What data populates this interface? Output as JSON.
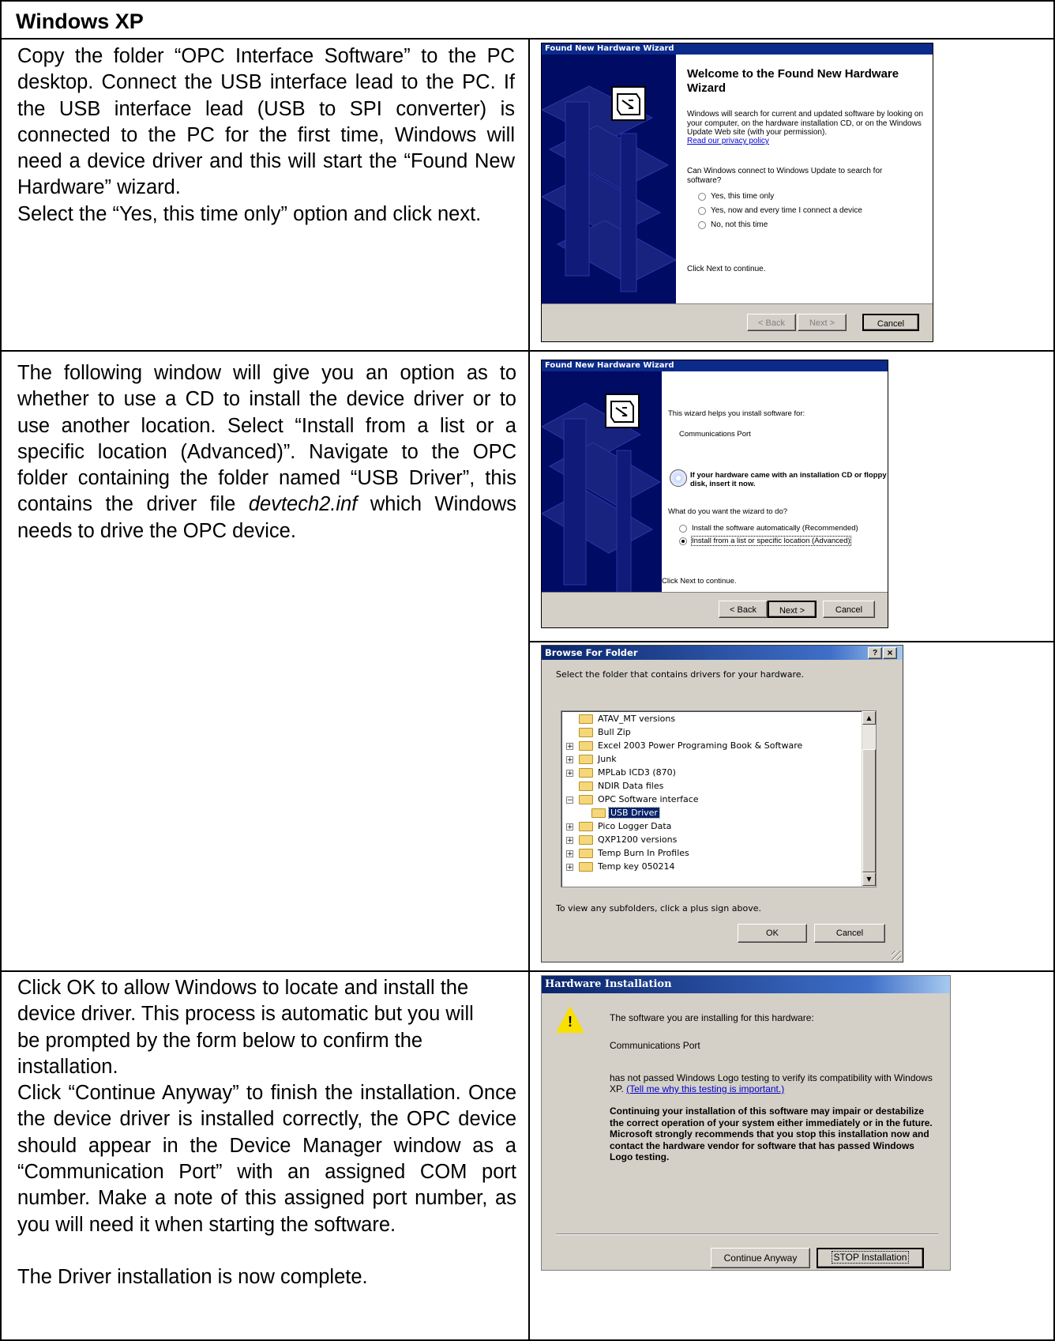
{
  "section_title": "Windows XP",
  "row1_text": "Copy the folder “OPC Interface Software” to the PC desktop.  Connect the USB interface lead to the PC.  If the USB interface lead (USB to SPI converter) is connected to the PC for the first time, Windows will need a device driver and this will start the “Found New Hardware” wizard.",
  "row1_text2": "Select the “Yes, this time only” option and click next.",
  "row2_text_a": "The following window will give you an option as to whether to use a CD to install the device driver or to use another location.  Select “Install from a list or a specific location (Advanced)”.  Navigate to the OPC folder containing the folder named “USB Driver”, this contains the driver file ",
  "row2_text_italic": "devtech2.inf",
  "row2_text_b": " which Windows needs to drive the OPC device.",
  "row3_text_a": "Click OK to allow Windows to locate and install the device driver.  This process is automatic but you will be prompted by the form below to confirm the installation.",
  "row3_text_b": "Click “Continue Anyway” to finish the installation.  Once the device driver is installed correctly, the OPC device should appear in the Device Manager window as a “Communication Port” with an assigned COM port number.  Make a note of this assigned port number, as you will need it when starting the software.",
  "row3_text_c": "The Driver installation is now complete.",
  "wizard1": {
    "title": "Found New Hardware Wizard",
    "heading": "Welcome to the Found New Hardware Wizard",
    "desc": "Windows will search for current and updated software by looking on your computer, on the hardware installation CD, or on the Windows Update Web site (with your permission).",
    "privacy_link": "Read our privacy policy",
    "question": "Can Windows connect to Windows Update to search for software?",
    "options": [
      "Yes, this time only",
      "Yes, now and every time I connect a device",
      "No, not this time"
    ],
    "continue_text": "Click Next to continue.",
    "back": "< Back",
    "next": "Next >",
    "cancel": "Cancel"
  },
  "wizard2": {
    "title": "Found New Hardware Wizard",
    "intro": "This wizard helps you install software for:",
    "device": "Communications Port",
    "cd_note": "If your hardware came with an installation CD or floppy disk, insert it now.",
    "question": "What do you want the wizard to do?",
    "options": [
      "Install the software automatically (Recommended)",
      "Install from a list or specific location (Advanced)"
    ],
    "continue_text": "Click Next to continue.",
    "back": "< Back",
    "next": "Next >",
    "cancel": "Cancel"
  },
  "browse": {
    "title": "Browse For Folder",
    "help_glyph": "?",
    "close_glyph": "×",
    "prompt": "Select the folder that contains drivers for your hardware.",
    "items": [
      "ATAV_MT versions",
      "Bull Zip",
      "Excel 2003 Power Programing Book & Software",
      "Junk",
      "MPLab ICD3 (870)",
      "NDIR Data files",
      "OPC Software interface",
      "USB Driver",
      "Pico Logger Data",
      "QXP1200  versions",
      "Temp Burn In Profiles",
      "Temp key 050214"
    ],
    "hint": "To view any subfolders, click a plus sign above.",
    "ok": "OK",
    "cancel": "Cancel"
  },
  "hwinstall": {
    "title": "Hardware Installation",
    "line1": "The software you are installing for this hardware:",
    "device": "Communications Port",
    "line2": "has not passed Windows Logo testing to verify its compatibility with Windows XP.",
    "link": "(Tell me why this testing is important.)",
    "warning": "Continuing your installation of this software may impair or destabilize the correct operation of your system either immediately or in the future. Microsoft strongly recommends that you stop this installation now and contact the hardware vendor for software that has passed Windows Logo testing.",
    "continue_btn": "Continue Anyway",
    "stop_btn": "STOP Installation"
  }
}
